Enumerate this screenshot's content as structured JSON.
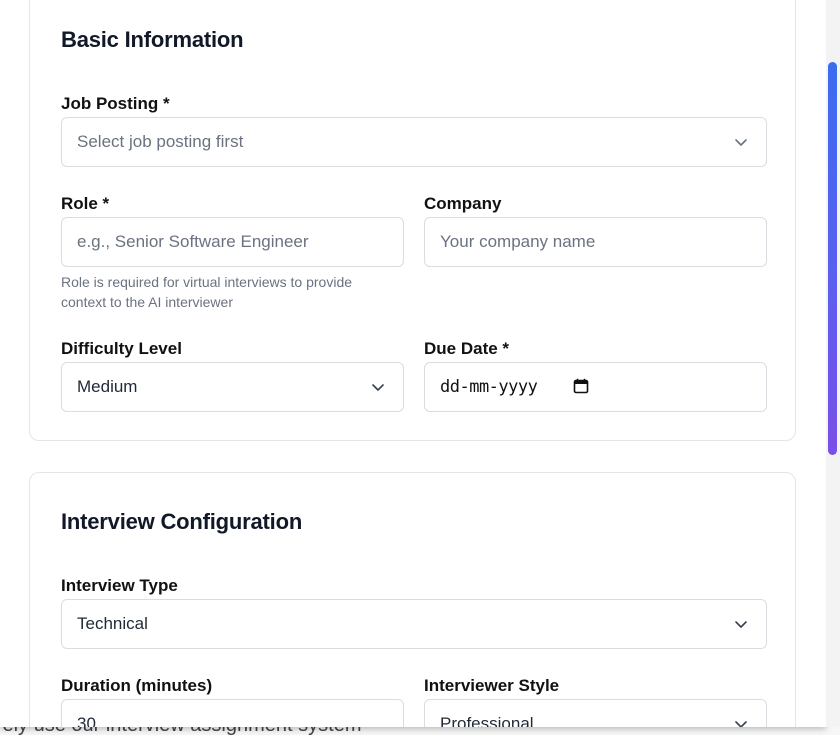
{
  "background": {
    "partial_text": "ively use our interview assignment system"
  },
  "basic_info": {
    "title": "Basic Information",
    "job_posting": {
      "label": "Job Posting *",
      "placeholder": "Select job posting first"
    },
    "role": {
      "label": "Role *",
      "placeholder": "e.g., Senior Software Engineer",
      "hint": "Role is required for virtual interviews to provide context to the AI interviewer"
    },
    "company": {
      "label": "Company",
      "placeholder": "Your company name"
    },
    "difficulty": {
      "label": "Difficulty Level",
      "value": "Medium"
    },
    "due_date": {
      "label": "Due Date *",
      "placeholder": "dd-mm-yyyy"
    }
  },
  "interview_config": {
    "title": "Interview Configuration",
    "interview_type": {
      "label": "Interview Type",
      "value": "Technical"
    },
    "duration": {
      "label": "Duration (minutes)",
      "value": "30"
    },
    "interviewer_style": {
      "label": "Interviewer Style",
      "value": "Professional"
    }
  },
  "colors": {
    "scrollbar_top": "#3b6cf0",
    "scrollbar_bottom": "#7a4fe8",
    "border": "#d9dce1",
    "placeholder": "#6b7280"
  },
  "icons": {
    "select_arrow": "chevron-down-icon",
    "date_picker": "calendar-icon"
  }
}
